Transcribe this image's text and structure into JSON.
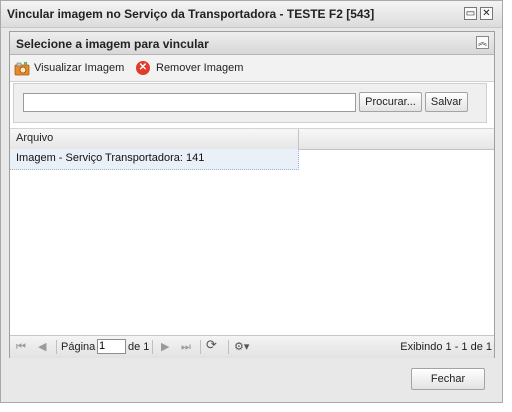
{
  "window": {
    "title": "Vincular imagem no Serviço da Transportadora - TESTE F2 [543]",
    "maximize_glyph": "▭",
    "close_glyph": "✕"
  },
  "panel": {
    "title": "Selecione a imagem para vincular",
    "collapse_glyph": "︽"
  },
  "toolbar": {
    "view_label": "Visualizar Imagem",
    "remove_label": "Remover Imagem",
    "view_icon": "camera-icon",
    "remove_icon": "remove-circle-icon",
    "remove_glyph": "✕"
  },
  "upload": {
    "file_value": "",
    "browse_label": "Procurar...",
    "save_label": "Salvar"
  },
  "grid": {
    "columns": [
      "Arquivo"
    ],
    "rows": [
      [
        "Imagem - Serviço Transportadora: 141"
      ]
    ]
  },
  "pager": {
    "first_glyph": "⏮",
    "prev_glyph": "◀",
    "page_label": "Página",
    "page_value": "1",
    "of_label": "de 1",
    "next_glyph": "▶",
    "last_glyph": "⏭",
    "refresh_glyph": "⟳",
    "settings_glyph": "⚙▾",
    "status": "Exibindo 1 - 1 de 1"
  },
  "footer": {
    "close_label": "Fechar"
  },
  "colors": {
    "remove_red": "#e23a2b",
    "selected_row": "#eaf0f8"
  }
}
